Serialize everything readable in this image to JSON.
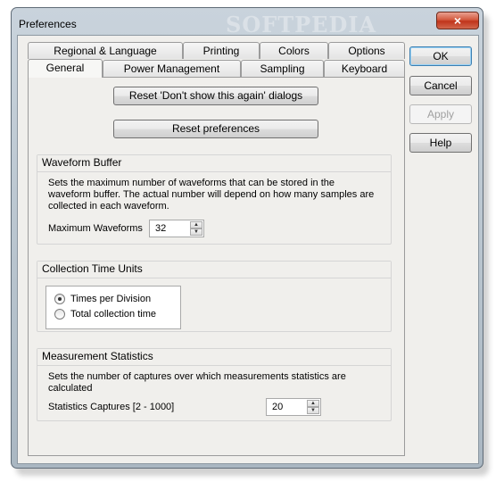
{
  "window": {
    "title": "Preferences",
    "watermark": "SOFTPEDIA",
    "close_symbol": "×"
  },
  "tabs": {
    "row_back": [
      "Regional & Language",
      "Printing",
      "Colors",
      "Options"
    ],
    "row_front": [
      "General",
      "Power Management",
      "Sampling",
      "Keyboard"
    ],
    "active": "General"
  },
  "buttons": {
    "ok": "OK",
    "cancel": "Cancel",
    "apply": "Apply",
    "help": "Help",
    "reset_dialogs": "Reset 'Don't show this again' dialogs",
    "reset_preferences": "Reset preferences"
  },
  "waveform_buffer": {
    "title": "Waveform Buffer",
    "description": "Sets the maximum number of waveforms that can be stored in the waveform buffer. The actual number will depend on how many samples are collected in each waveform.",
    "field_label": "Maximum Waveforms",
    "value": "32"
  },
  "collection_time": {
    "title": "Collection Time Units",
    "options": [
      "Times per Division",
      "Total collection time"
    ],
    "selected": "Times per Division"
  },
  "measurement_stats": {
    "title": "Measurement Statistics",
    "description": "Sets the number of captures over which measurements statistics are calculated",
    "field_label": "Statistics Captures [2 - 1000]",
    "value": "20"
  },
  "colors": {
    "accent": "#3c7fb1",
    "close_button": "#c0341b",
    "dialog_bg": "#f0efec"
  }
}
